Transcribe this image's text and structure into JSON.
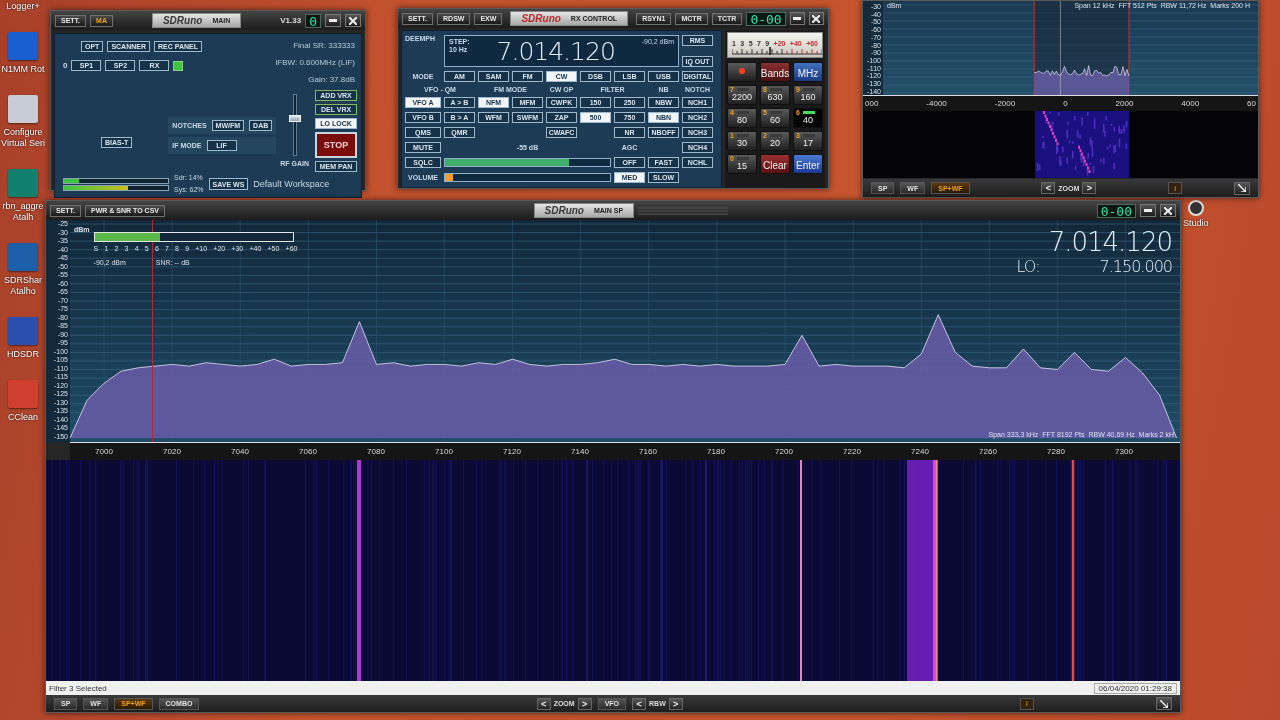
{
  "desktop_icons": [
    {
      "kind": "text",
      "lines": [
        "Logger+"
      ]
    },
    {
      "kind": "tile",
      "lines": [
        "N1MM Rot"
      ],
      "color": "#1a5fd0"
    },
    {
      "kind": "tile",
      "lines": [
        "Configure",
        "Virtual Seri"
      ],
      "color": "#c8ccd4"
    },
    {
      "kind": "tile",
      "lines": [
        "rbn_aggre",
        "Atalh"
      ],
      "color": "#12806e"
    },
    {
      "kind": "tile",
      "lines": [
        "SDRShar",
        "Atalho"
      ],
      "color": "#1d5fa8"
    },
    {
      "kind": "tile",
      "lines": [
        "HDSDR"
      ],
      "color": "#2b4fb0"
    },
    {
      "kind": "tile",
      "lines": [
        "CClean"
      ],
      "color": "#d04030"
    }
  ],
  "studio_icon": {
    "label": "Studio"
  },
  "main_window": {
    "sett": "SETT.",
    "ma": {
      "label": "MA",
      "selected": true
    },
    "logo": "SDRuno",
    "title": "MAIN",
    "version": "V1.33",
    "digit": "0",
    "top_buttons": [
      "OPT",
      "SCANNER",
      "REC PANEL"
    ],
    "row_index": "0",
    "sp_buttons": [
      "SP1",
      "SP2",
      "RX"
    ],
    "rx_active": true,
    "info": [
      "Final SR: 333333",
      "IFBW: 0.600MHz (LIF)",
      "Gain: 37.8dB"
    ],
    "notches": {
      "label": "NOTCHES",
      "buttons": [
        "MW/FM",
        "DAB"
      ]
    },
    "if_mode": {
      "label": "IF MODE",
      "value": "LIF"
    },
    "bias_t": "BIAS-T",
    "rf_gain": {
      "label": "RF GAIN",
      "level": 0.62
    },
    "side_buttons": [
      {
        "label": "ADD VRX",
        "selected": false
      },
      {
        "label": "DEL VRX",
        "selected": false
      },
      {
        "label": "LO LOCK",
        "selected": true
      }
    ],
    "stop": "STOP",
    "mem_pan": "MEM PAN",
    "cpu": [
      {
        "label": "Sdr: 14%",
        "level": 0.14
      },
      {
        "label": "Sys: 62%",
        "level": 0.62
      }
    ],
    "save_ws": "SAVE WS",
    "workspace": "Default Workspace"
  },
  "rx_control": {
    "tabs": [
      "SETT.",
      "RDSW",
      "EXW"
    ],
    "logo": "SDRuno",
    "title": "RX CONTROL",
    "right_tabs": [
      "RSYN1",
      "MCTR",
      "TCTR"
    ],
    "clock": "0-00",
    "deemph": "DEEMPH",
    "step_label": "STEP:",
    "step": "10 Hz",
    "frequency": "7.014.120",
    "level_reading": "-90,2 dBm",
    "display_buttons": [
      "RMS",
      "IQ OUT"
    ],
    "mode_row": [
      {
        "kind": "label",
        "label": "MODE"
      },
      {
        "kind": "button",
        "label": "AM",
        "selected": false
      },
      {
        "kind": "button",
        "label": "SAM",
        "selected": false
      },
      {
        "kind": "button",
        "label": "FM",
        "selected": false
      },
      {
        "kind": "button",
        "label": "CW",
        "selected": true
      },
      {
        "kind": "button",
        "label": "DSB",
        "selected": false
      },
      {
        "kind": "button",
        "label": "LSB",
        "selected": false
      },
      {
        "kind": "button",
        "label": "USB",
        "selected": false
      },
      {
        "kind": "button",
        "label": "DIGITAL",
        "selected": false
      }
    ],
    "headings": [
      {
        "label": "VFO - QM",
        "wide": true
      },
      {
        "label": "FM MODE",
        "wide": true
      },
      {
        "label": "CW OP",
        "wide": false
      },
      {
        "label": "FILTER",
        "wide": true
      },
      {
        "label": "NB",
        "wide": false
      },
      {
        "label": "NOTCH",
        "wide": false
      }
    ],
    "rows": [
      [
        {
          "kind": "button",
          "label": "VFO A",
          "selected": true
        },
        {
          "kind": "button",
          "label": "A > B",
          "selected": false
        },
        {
          "kind": "button",
          "label": "NFM",
          "selected": true
        },
        {
          "kind": "button",
          "label": "MFM",
          "selected": false
        },
        {
          "kind": "button",
          "label": "CWPK",
          "selected": false
        },
        {
          "kind": "button",
          "label": "150",
          "selected": false
        },
        {
          "kind": "button",
          "label": "250",
          "selected": false
        },
        {
          "kind": "button",
          "label": "NBW",
          "selected": false
        },
        {
          "kind": "button",
          "label": "NCH1",
          "selected": false
        }
      ],
      [
        {
          "kind": "button",
          "label": "VFO B",
          "selected": false
        },
        {
          "kind": "button",
          "label": "B > A",
          "selected": false
        },
        {
          "kind": "button",
          "label": "WFM",
          "selected": false
        },
        {
          "kind": "button",
          "label": "SWFM",
          "selected": false
        },
        {
          "kind": "button",
          "label": "ZAP",
          "selected": false
        },
        {
          "kind": "button",
          "label": "500",
          "selected": true
        },
        {
          "kind": "button",
          "label": "750",
          "selected": false
        },
        {
          "kind": "button",
          "label": "NBN",
          "selected": true
        },
        {
          "kind": "button",
          "label": "NCH2",
          "selected": false
        }
      ],
      [
        {
          "kind": "button",
          "label": "QMS",
          "selected": false
        },
        {
          "kind": "button",
          "label": "QMR",
          "selected": false
        },
        {
          "kind": "gap"
        },
        {
          "kind": "gap"
        },
        {
          "kind": "button",
          "label": "CWAFC",
          "selected": false
        },
        {
          "kind": "gap"
        },
        {
          "kind": "button",
          "label": "NR",
          "selected": false
        },
        {
          "kind": "button",
          "label": "NBOFF",
          "selected": false
        },
        {
          "kind": "button",
          "label": "NCH3",
          "selected": false
        }
      ],
      [
        {
          "kind": "button",
          "label": "MUTE",
          "selected": false
        },
        {
          "kind": "caption",
          "label": "-55 dB"
        },
        {
          "kind": "label",
          "label": "AGC"
        },
        {
          "kind": "gap"
        },
        {
          "kind": "button",
          "label": "NCH4",
          "selected": false
        }
      ],
      [
        {
          "kind": "button",
          "label": "SQLC",
          "selected": false
        },
        {
          "kind": "meter",
          "level": 0.75,
          "color": "#3fae6a"
        },
        {
          "kind": "button",
          "label": "OFF",
          "selected": false
        },
        {
          "kind": "button",
          "label": "FAST",
          "selected": false
        },
        {
          "kind": "button",
          "label": "NCHL",
          "selected": false
        }
      ],
      [
        {
          "kind": "label",
          "label": "VOLUME"
        },
        {
          "kind": "meter",
          "level": 0.05,
          "color": "#f0a030"
        },
        {
          "kind": "button",
          "label": "MED",
          "selected": true
        },
        {
          "kind": "button",
          "label": "SLOW",
          "selected": false
        },
        {
          "kind": "gap"
        }
      ]
    ],
    "meter_scale": [
      "1",
      "3",
      "5",
      "7",
      "9",
      "+20",
      "+40",
      "+60"
    ],
    "keys": [
      {
        "kind": "dot",
        "selected": false
      },
      {
        "kind": "bands",
        "label": "Bands",
        "selected": false
      },
      {
        "kind": "mhz",
        "label": "MHz",
        "selected": false
      },
      {
        "kind": "band",
        "digit": "7",
        "label": "2200",
        "selected": false
      },
      {
        "kind": "band",
        "digit": "8",
        "label": "630",
        "selected": false
      },
      {
        "kind": "band",
        "digit": "9",
        "label": "160",
        "selected": false
      },
      {
        "kind": "band",
        "digit": "4",
        "label": "80",
        "selected": false
      },
      {
        "kind": "band",
        "digit": "5",
        "label": "60",
        "selected": false
      },
      {
        "kind": "band",
        "digit": "6",
        "label": "40",
        "selected": true
      },
      {
        "kind": "band",
        "digit": "1",
        "label": "30",
        "selected": false
      },
      {
        "kind": "band",
        "digit": "2",
        "label": "20",
        "selected": false
      },
      {
        "kind": "band",
        "digit": "3",
        "label": "17",
        "selected": false
      },
      {
        "kind": "band",
        "digit": "0",
        "label": "15",
        "selected": false
      },
      {
        "kind": "clear",
        "label": "Clear",
        "selected": false
      },
      {
        "kind": "enter",
        "label": "Enter",
        "selected": false
      }
    ]
  },
  "zoom_window": {
    "info": "Span 12 kHz  FFT 512 Pts  RBW 11,72 Hz  Marks 200 H",
    "unit": "dBm",
    "y_labels": [
      "-30",
      "-40",
      "-50",
      "-60",
      "-70",
      "-80",
      "-90",
      "-100",
      "-110",
      "-120",
      "-130",
      "-140"
    ],
    "x_labels": [
      "000",
      "-4000",
      "-2000",
      "0",
      "2000",
      "4000",
      "60"
    ],
    "view_buttons": [
      {
        "label": "SP",
        "selected": false
      },
      {
        "label": "WF",
        "selected": false
      },
      {
        "label": "SP+WF",
        "selected": true
      }
    ],
    "zoom": {
      "prev": "<",
      "label": "ZOOM",
      "next": ">"
    },
    "info_button": "i"
  },
  "main_sp": {
    "sett": "SETT.",
    "csv_button": "PWR & SNR TO CSV",
    "logo": "SDRuno",
    "title": "MAIN SP",
    "clock": "0-00",
    "dbm_label": "dBm",
    "smeter": {
      "level": 0.33,
      "scale": [
        "S",
        "1",
        "2",
        "3",
        "4",
        "5",
        "6",
        "7",
        "8",
        "9",
        "+10",
        "+20",
        "+30",
        "+40",
        "+50",
        "+60"
      ],
      "reading": "-90,2 dBm",
      "snr": "SNR: -- dB"
    },
    "chart_data": {
      "type": "area",
      "grid": true,
      "xlim": [
        6990,
        7316
      ],
      "ylim": [
        -150,
        -25
      ],
      "xticks": [
        7000,
        7020,
        7040,
        7060,
        7080,
        7100,
        7120,
        7140,
        7160,
        7180,
        7200,
        7220,
        7240,
        7260,
        7280,
        7300
      ],
      "yticks": [
        -25,
        -30,
        -35,
        -40,
        -45,
        -50,
        -55,
        -60,
        -65,
        -70,
        -75,
        -80,
        -85,
        -90,
        -95,
        -100,
        -105,
        -110,
        -115,
        -120,
        -125,
        -130,
        -135,
        -140,
        -145,
        -150
      ],
      "x": [
        6990,
        6995,
        7000,
        7005,
        7010,
        7015,
        7020,
        7025,
        7030,
        7035,
        7040,
        7045,
        7050,
        7055,
        7060,
        7065,
        7070,
        7075,
        7080,
        7085,
        7090,
        7095,
        7100,
        7105,
        7110,
        7115,
        7120,
        7125,
        7130,
        7135,
        7140,
        7145,
        7150,
        7155,
        7160,
        7165,
        7170,
        7175,
        7180,
        7185,
        7190,
        7195,
        7200,
        7205,
        7210,
        7215,
        7220,
        7225,
        7230,
        7235,
        7240,
        7245,
        7250,
        7255,
        7260,
        7265,
        7270,
        7275,
        7280,
        7285,
        7290,
        7295,
        7300,
        7305,
        7310,
        7315
      ],
      "series": [
        {
          "color": "#e4e0f6",
          "values": [
            -150,
            -128,
            -118,
            -111,
            -109,
            -108,
            -107,
            -108,
            -106,
            -107,
            -108,
            -107,
            -104,
            -108,
            -107,
            -107,
            -106,
            -82,
            -107,
            -106,
            -108,
            -107,
            -107,
            -108,
            -106,
            -107,
            -104,
            -107,
            -108,
            -107,
            -107,
            -106,
            -104,
            -107,
            -107,
            -108,
            -107,
            -108,
            -107,
            -108,
            -108,
            -108,
            -107,
            -90,
            -108,
            -107,
            -108,
            -108,
            -108,
            -109,
            -101,
            -78,
            -100,
            -108,
            -109,
            -109,
            -98,
            -109,
            -110,
            -100,
            -110,
            -111,
            -103,
            -112,
            -125,
            -150
          ]
        }
      ]
    },
    "frequency": "7.014.120",
    "lo_label": "LO:",
    "lo_frequency": "7.150.000",
    "info": "Span 333,3 kHz  FFT 8192 Pts  RBW 40,69 Hz  Marks 2 kH",
    "status": "Filter 3 Selected",
    "timestamp": "06/04/2020 01:29:38",
    "view_buttons": [
      {
        "label": "SP",
        "selected": false
      },
      {
        "label": "WF",
        "selected": false
      },
      {
        "label": "SP+WF",
        "selected": true
      },
      {
        "label": "COMBO",
        "selected": false
      }
    ],
    "zoom": {
      "prev": "<",
      "label": "ZOOM",
      "next": ">"
    },
    "vfo": "VFO",
    "rbw": {
      "prev": "<",
      "label": "RBW",
      "next": ">"
    },
    "info_button": "i"
  }
}
